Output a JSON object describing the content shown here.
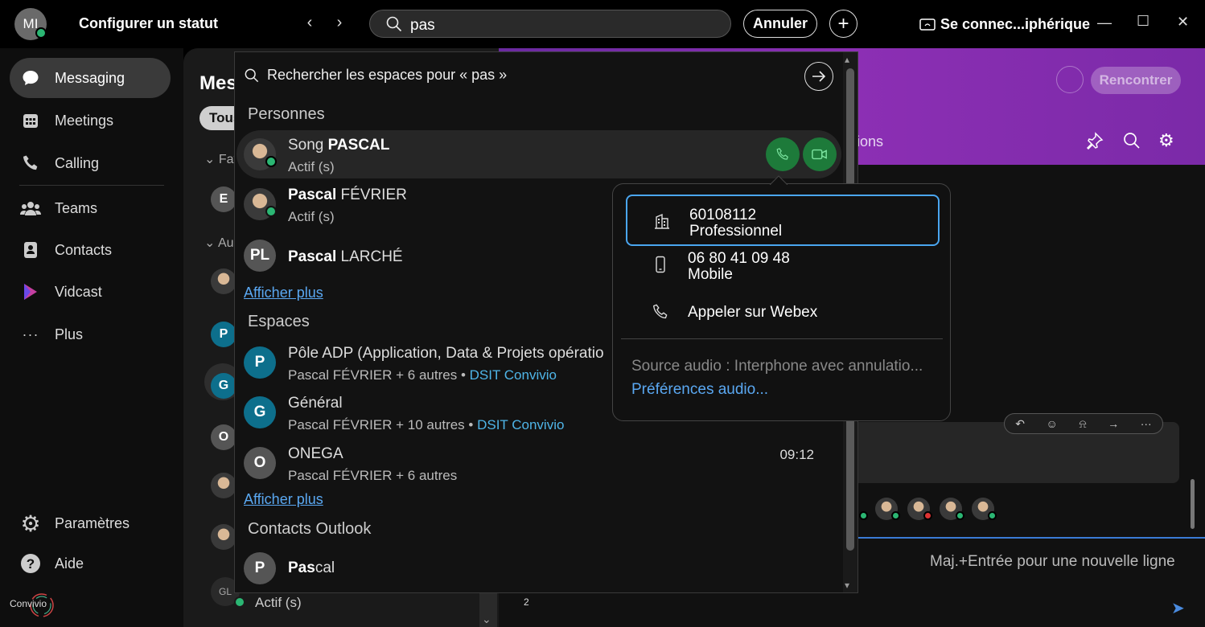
{
  "titlebar": {
    "avatar_initials": "MI",
    "status_title": "Configurer un statut",
    "search_value": "pas",
    "cancel_label": "Annuler",
    "add_label": "+",
    "connect_label": "Se connec...iphérique"
  },
  "nav": {
    "items": [
      {
        "label": "Messaging"
      },
      {
        "label": "Meetings"
      },
      {
        "label": "Calling"
      },
      {
        "label": "Teams"
      },
      {
        "label": "Contacts"
      },
      {
        "label": "Vidcast"
      },
      {
        "label": "Plus"
      }
    ],
    "settings_label": "Paramètres",
    "help_label": "Aide",
    "logo_text": "Convivio"
  },
  "spaces": {
    "title": "Mes",
    "filter_chip": "Tous",
    "favorites_label": "Fav",
    "other_label": "Au",
    "bottom_status": "Actif (s)",
    "bottom_initials": "GL",
    "letters": [
      "E",
      "P",
      "G",
      "O"
    ]
  },
  "space": {
    "meet_label": "Rencontrer",
    "tab_fragment": "ions",
    "compose_placeholder": "Maj.+Entrée pour une nouvelle ligne",
    "count": "2"
  },
  "search": {
    "query_text": "Rechercher les espaces pour « pas »",
    "people_label": "Personnes",
    "people": [
      {
        "first": "Song ",
        "last": "PASCAL",
        "status": "Actif (s)"
      },
      {
        "first": "Pascal",
        "last": " FÉVRIER",
        "status": "Actif (s)"
      },
      {
        "initials": "PL",
        "first": "Pascal",
        "last": " LARCHÉ"
      }
    ],
    "show_more_1": "Afficher plus",
    "spaces_label": "Espaces",
    "spaces": [
      {
        "initial": "P",
        "title": "Pôle ADP (Application, Data & Projets opératio",
        "members": "Pascal FÉVRIER + 6 autres",
        "sep": " • ",
        "org": "DSIT Convivio"
      },
      {
        "initial": "G",
        "title": "Général",
        "members": "Pascal FÉVRIER + 10 autres",
        "sep": " • ",
        "org": "DSIT Convivio"
      },
      {
        "initial": "O",
        "title": "ONEGA",
        "members": "Pascal FÉVRIER + 6 autres",
        "time": "09:12"
      }
    ],
    "show_more_2": "Afficher plus",
    "outlook_label": "Contacts Outlook",
    "outlook": {
      "initial": "P",
      "bold": "Pas",
      "rest": "cal"
    }
  },
  "call_popup": {
    "items": [
      {
        "line1": "60108112",
        "line2": "Professionnel"
      },
      {
        "line1": "06 80 41 09 48",
        "line2": "Mobile"
      },
      {
        "line1": "Appeler sur Webex"
      }
    ],
    "audio_source": "Source audio : Interphone avec annulatio...",
    "audio_prefs": "Préférences audio..."
  },
  "colors": {
    "accent_blue": "#4aa6f0",
    "call_green": "#1d7a3a",
    "presence_green": "#2bb673",
    "space_teal": "#0d6f8c",
    "header_purple": "#8c2fb4"
  }
}
